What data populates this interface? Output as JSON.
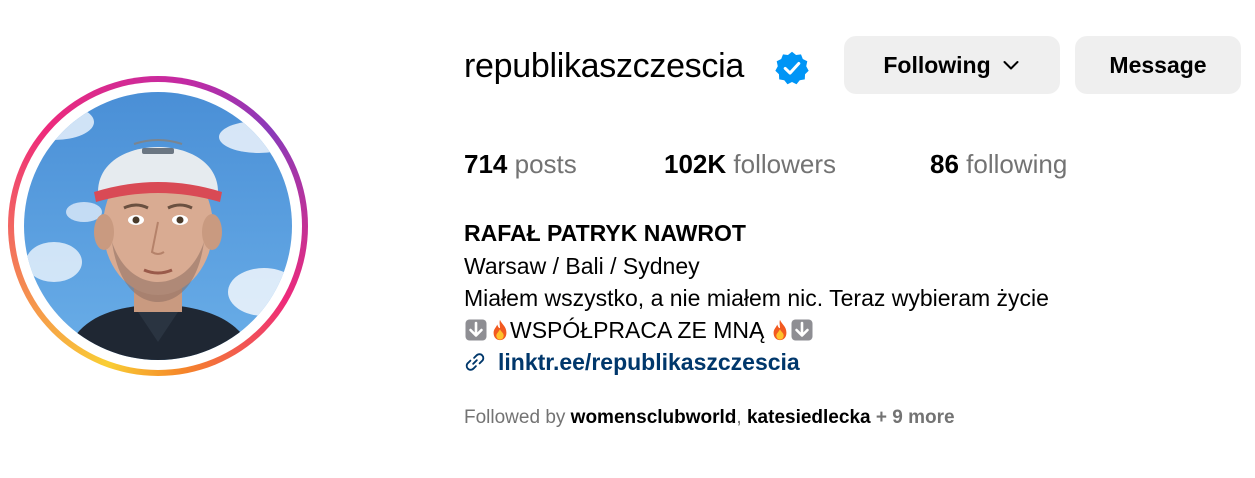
{
  "profile": {
    "username": "republikaszczescia",
    "verified": true,
    "avatar_alt": "profile-photo"
  },
  "actions": {
    "following_label": "Following",
    "message_label": "Message"
  },
  "stats": {
    "posts_count": "714",
    "posts_label": "posts",
    "followers_count": "102K",
    "followers_label": "followers",
    "following_count": "86",
    "following_label": "following"
  },
  "bio": {
    "full_name": "RAFAŁ PATRYK NAWROT",
    "line1": "Warsaw / Bali / Sydney",
    "line2": "Miałem wszystko, a nie miałem nic. Teraz wybieram życie",
    "line3_text": "WSPÓŁPRACA ZE MNĄ",
    "link": "linktr.ee/republikaszczescia"
  },
  "followed_by": {
    "prefix": "Followed by",
    "accounts": [
      "womensclubworld",
      "katesiedlecka"
    ],
    "separator": ",",
    "more": "+ 9 more"
  },
  "colors": {
    "verified_blue": "#0095f6",
    "link_blue": "#00376b",
    "muted_gray": "#737373",
    "button_bg": "#efefef"
  },
  "icons": {
    "verified": "verified-badge-icon",
    "chevron": "chevron-down-icon",
    "link": "link-icon",
    "emoji_down": "down-arrow-emoji-icon",
    "emoji_fire": "fire-emoji-icon"
  }
}
